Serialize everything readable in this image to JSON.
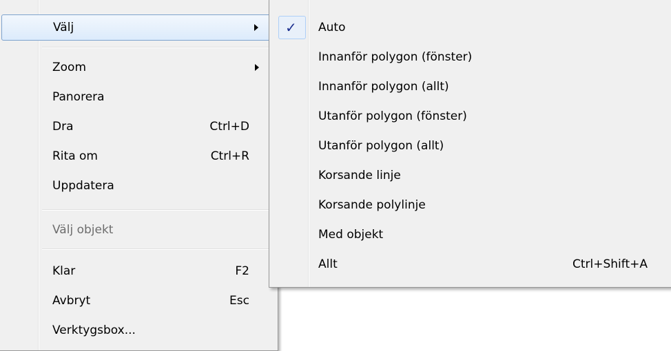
{
  "main_menu": {
    "items": [
      {
        "label": "Välj",
        "shortcut": "",
        "submenu": true,
        "highlighted": true,
        "disabled": false
      },
      {
        "label": "Zoom",
        "shortcut": "",
        "submenu": true,
        "highlighted": false,
        "disabled": false
      },
      {
        "label": "Panorera",
        "shortcut": "",
        "submenu": false,
        "highlighted": false,
        "disabled": false
      },
      {
        "label": "Dra",
        "shortcut": "Ctrl+D",
        "submenu": false,
        "highlighted": false,
        "disabled": false
      },
      {
        "label": "Rita om",
        "shortcut": "Ctrl+R",
        "submenu": false,
        "highlighted": false,
        "disabled": false
      },
      {
        "label": "Uppdatera",
        "shortcut": "",
        "submenu": false,
        "highlighted": false,
        "disabled": false
      },
      {
        "label": "Välj objekt",
        "shortcut": "",
        "submenu": false,
        "highlighted": false,
        "disabled": true
      },
      {
        "label": "Klar",
        "shortcut": "F2",
        "submenu": false,
        "highlighted": false,
        "disabled": false
      },
      {
        "label": "Avbryt",
        "shortcut": "Esc",
        "submenu": false,
        "highlighted": false,
        "disabled": false
      },
      {
        "label": "Verktygsbox...",
        "shortcut": "",
        "submenu": false,
        "highlighted": false,
        "disabled": false
      }
    ]
  },
  "sub_menu": {
    "items": [
      {
        "label": "Auto",
        "shortcut": "",
        "checked": true
      },
      {
        "label": "Innanför polygon (fönster)",
        "shortcut": "",
        "checked": false
      },
      {
        "label": "Innanför polygon (allt)",
        "shortcut": "",
        "checked": false
      },
      {
        "label": "Utanför polygon (fönster)",
        "shortcut": "",
        "checked": false
      },
      {
        "label": "Utanför polygon (allt)",
        "shortcut": "",
        "checked": false
      },
      {
        "label": "Korsande linje",
        "shortcut": "",
        "checked": false
      },
      {
        "label": "Korsande polylinje",
        "shortcut": "",
        "checked": false
      },
      {
        "label": "Med objekt",
        "shortcut": "",
        "checked": false
      },
      {
        "label": "Allt",
        "shortcut": "Ctrl+Shift+A",
        "checked": false
      }
    ],
    "check_glyph": "✓"
  },
  "colors": {
    "menu_bg": "#f0f0f0",
    "highlight_border": "#7da2ce",
    "check_color": "#1c2f8f",
    "disabled_text": "#6d6d6d"
  }
}
